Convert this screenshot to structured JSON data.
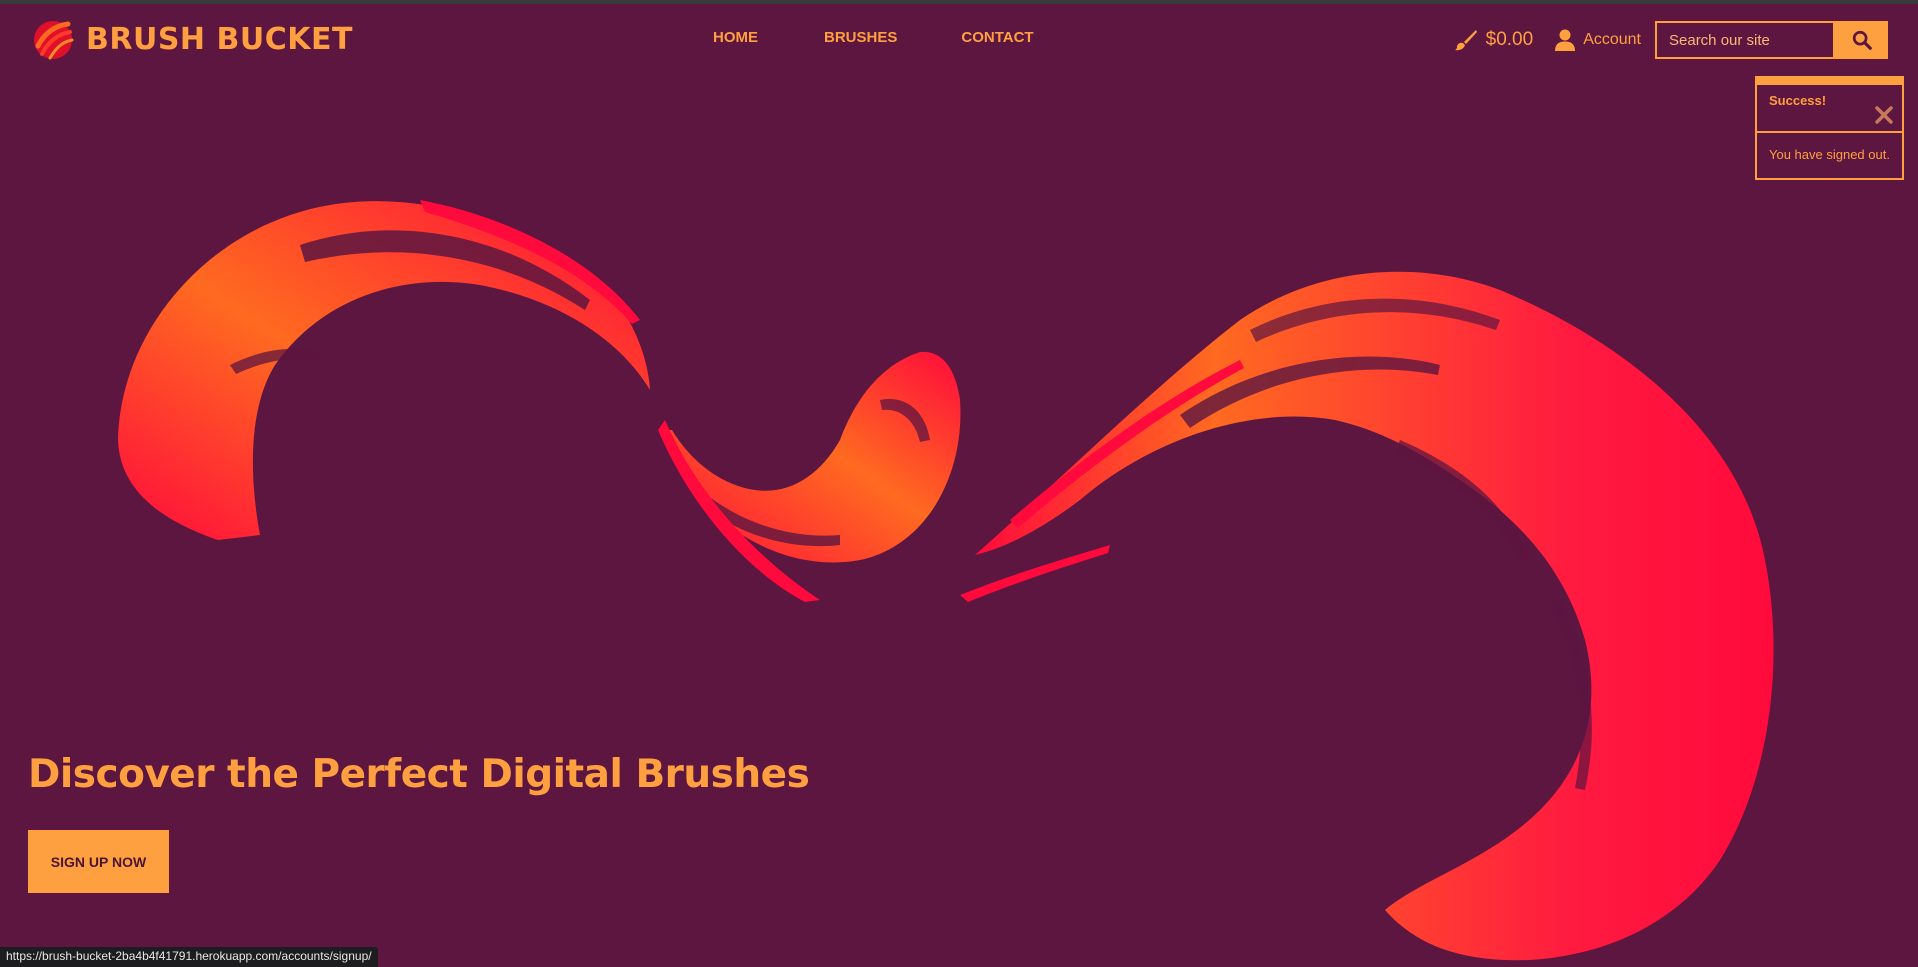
{
  "header": {
    "brand_name": "BRUSH BUCKET",
    "nav": [
      {
        "label": "HOME"
      },
      {
        "label": "BRUSHES"
      },
      {
        "label": "CONTACT"
      }
    ],
    "bag_total": "$0.00",
    "account_label": "Account",
    "search_placeholder": "Search our site"
  },
  "toast": {
    "title": "Success!",
    "message": "You have signed out."
  },
  "hero": {
    "headline": "Discover the Perfect Digital Brushes",
    "cta_label": "SIGN UP NOW"
  },
  "status_bar": {
    "url": "https://brush-bucket-2ba4b4f41791.herokuapp.com/accounts/signup/"
  },
  "colors": {
    "background": "#5d1640",
    "accent": "#ffa040",
    "stroke_red": "#ff0a3c",
    "stroke_orange": "#ff6a20"
  }
}
